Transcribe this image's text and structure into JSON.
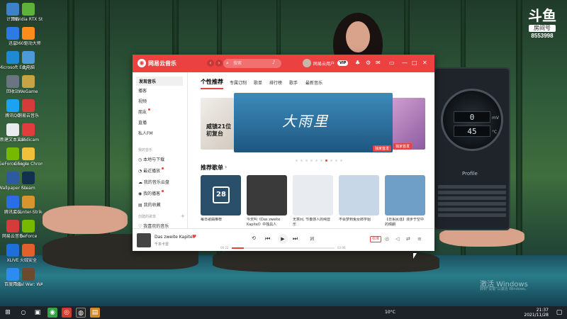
{
  "desktop": {
    "icons": [
      {
        "label": "计算器",
        "color": "#3d82c9"
      },
      {
        "label": "Nvidia RTX Studio 9",
        "color": "#5cb23a"
      },
      {
        "label": "迅雷",
        "color": "#2c7be5"
      },
      {
        "label": "360驱动大师",
        "color": "#ff8c1a"
      },
      {
        "label": "Microsoft Edge",
        "color": "#1f8ad2"
      },
      {
        "label": "此电脑",
        "color": "#4c9ad8"
      },
      {
        "label": "回收站",
        "color": "#6a7582"
      },
      {
        "label": "WeGame",
        "color": "#c7a345"
      },
      {
        "label": "腾讯QQ",
        "color": "#1da1f2"
      },
      {
        "label": "网易云音乐",
        "color": "#d43c3c"
      },
      {
        "label": "新建文本文档",
        "color": "#e9ecef"
      },
      {
        "label": "Bandicam",
        "color": "#e23c3c"
      },
      {
        "label": "GeForce Experience",
        "color": "#76b900"
      },
      {
        "label": "Google Chrome",
        "color": "#f0c03a"
      },
      {
        "label": "Wallpaper Engine",
        "color": "#2e5aa0"
      },
      {
        "label": "Steam",
        "color": "#13304f"
      },
      {
        "label": "腾讯会议",
        "color": "#2b6de6"
      },
      {
        "label": "Counter-Strike Global Offensive",
        "color": "#d9952d"
      },
      {
        "label": "网易云音乐",
        "color": "#d43c3c"
      },
      {
        "label": "GeForce",
        "color": "#76b900"
      },
      {
        "label": "XLIVE",
        "color": "#1e6fd9"
      },
      {
        "label": "火绒安全",
        "color": "#e2602b"
      },
      {
        "label": "百度网盘",
        "color": "#2d8cf0"
      },
      {
        "label": "Total War: WARHAMMER",
        "color": "#6b4a2d"
      }
    ],
    "activate_title": "激活 Windows",
    "activate_sub": "转到\"设置\"以激活 Windows。"
  },
  "douyu": {
    "logo": "斗鱼",
    "sub": "房间号",
    "room": "8553998"
  },
  "gauge": {
    "readout_top": "0",
    "readout_top_unit": "mV",
    "readout_bottom": "45",
    "readout_bottom_unit": "°C",
    "profile_label": "Profile"
  },
  "app": {
    "title": "网易云音乐",
    "search_placeholder": "搜索",
    "username": "网易云用户",
    "vip_badge": "VIP",
    "back_arrow": "‹",
    "forward_arrow": "›"
  },
  "sidebar": {
    "items": [
      {
        "label": "发现音乐",
        "active": true,
        "dot": false
      },
      {
        "label": "播客",
        "active": false,
        "dot": false
      },
      {
        "label": "视频",
        "active": false,
        "dot": false
      },
      {
        "label": "朋友",
        "active": false,
        "dot": true
      },
      {
        "label": "直播",
        "active": false,
        "dot": false
      },
      {
        "label": "私人FM",
        "active": false,
        "dot": false
      }
    ],
    "section_mine": "我的音乐",
    "mine_items": [
      {
        "label": "本地与下载",
        "dot": false
      },
      {
        "label": "最近播放",
        "dot": true
      },
      {
        "label": "我的音乐云盘",
        "dot": false
      },
      {
        "label": "我的播客",
        "dot": true
      },
      {
        "label": "我的收藏",
        "dot": false
      }
    ],
    "section_created": "创建的歌单",
    "liked": "我喜欢的音乐"
  },
  "tabs": [
    "个性推荐",
    "专属订制",
    "歌单",
    "排行榜",
    "歌手",
    "最新音乐"
  ],
  "banner": {
    "main_title": "大雨里",
    "tag_main": "独家首发",
    "tag_right": "独家首发",
    "left_text": "威镇21位 初复台",
    "dot_count": 10,
    "active_dot": 6
  },
  "recommend": {
    "title": "推荐歌单",
    "arrow": "›",
    "cards": [
      {
        "caption": "每日歌曲推荐",
        "badge": "28",
        "color": "#2a4f6b"
      },
      {
        "caption": "今天叫《Das zweite Kapitel》中独具人",
        "count": "",
        "color": "#3a3a3a"
      },
      {
        "caption": "无意间, 节奏感人的纯音乐",
        "count": "",
        "color": "#e8ecf0"
      },
      {
        "caption": "不会梦到兔女郎学姐",
        "count": "",
        "color": "#c7d7e8"
      },
      {
        "caption": "【日系民谣】漫步于空中的晴朗",
        "count": "",
        "color": "#6f9ec7"
      }
    ]
  },
  "player": {
    "song": "Das zweite Kapitel",
    "artist": "千本卡雷",
    "time_current": "00:22",
    "time_total": "03:06",
    "progress": 0.12,
    "quality": "标准",
    "controls": {
      "like": "♥",
      "prev": "⏮",
      "play": "▶",
      "next": "⏭",
      "mode": "⟲",
      "lyric": "词"
    }
  },
  "taskbar": {
    "weather": "10°C",
    "time": "21:37",
    "date": "2021/11/28"
  }
}
